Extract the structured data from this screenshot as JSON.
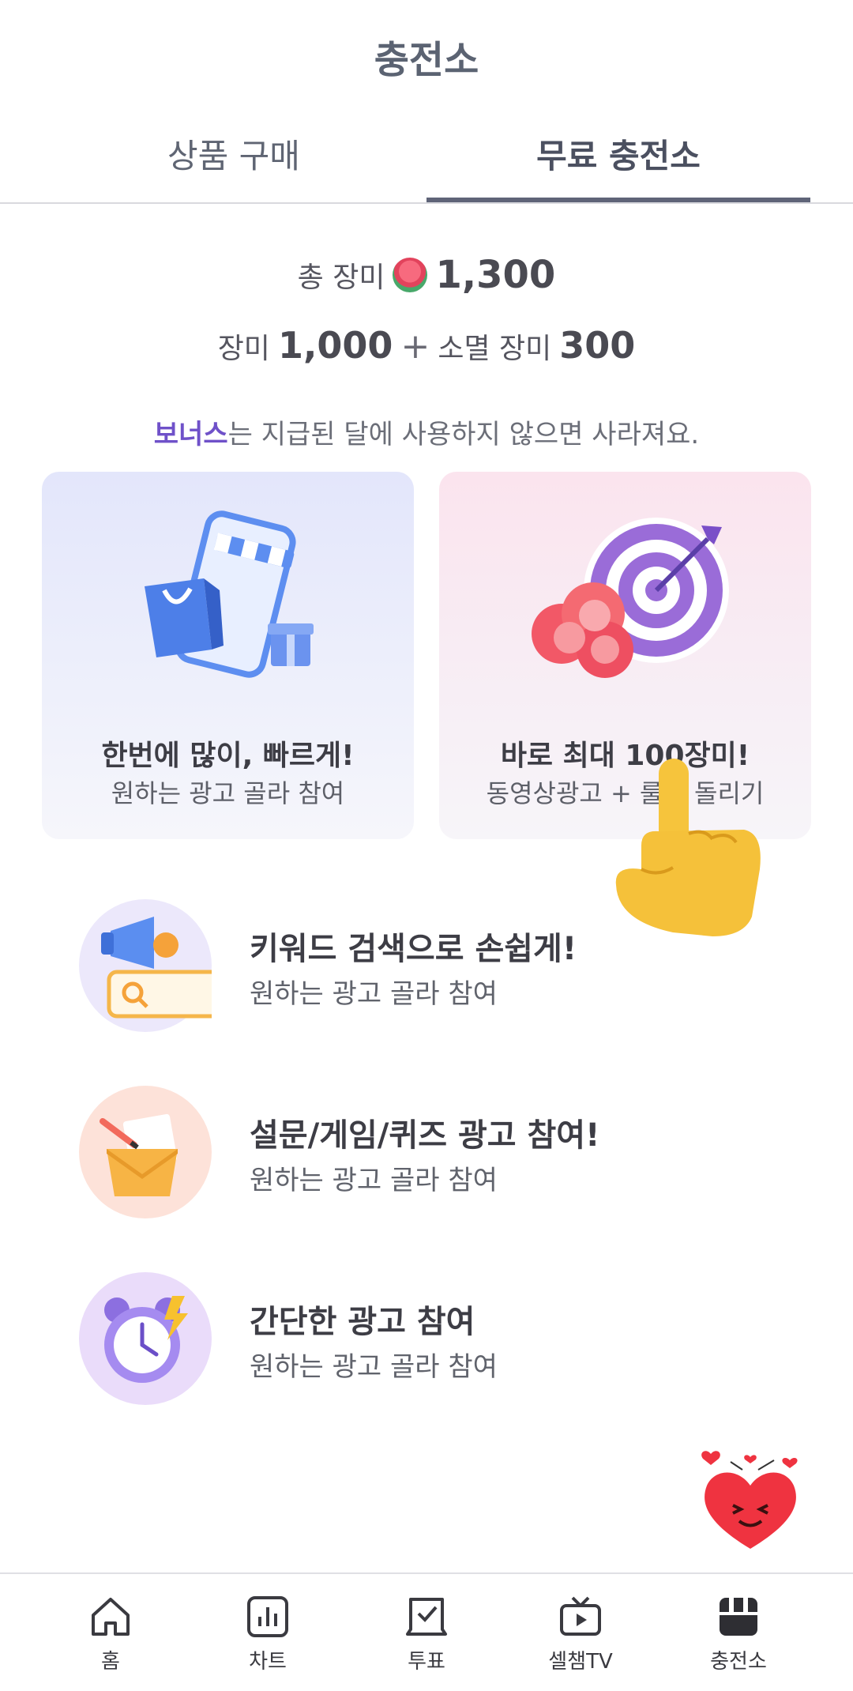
{
  "header": {
    "title": "충전소"
  },
  "tabs": [
    {
      "label": "상품 구매"
    },
    {
      "label": "무료 충전소",
      "active": true
    }
  ],
  "balance": {
    "total_label": "총 장미",
    "total_value": "1,300",
    "rose_label": "장미",
    "rose_value": "1,000",
    "plus": "+",
    "expiring_label": "소멸 장미",
    "expiring_value": "300"
  },
  "notice": {
    "bonus": "보너스",
    "text": "는 지급된 달에 사용하지 않으면 사라져요."
  },
  "cards": [
    {
      "title": "한번에 많이, 빠르게!",
      "subtitle": "원하는 광고 골라 참여",
      "icon": "shopping-phone-icon"
    },
    {
      "title": "바로 최대 100장미!",
      "subtitle": "동영상광고 + 룰렛 돌리기",
      "icon": "target-roses-icon"
    }
  ],
  "list": [
    {
      "title": "키워드 검색으로 손쉽게!",
      "subtitle": "원하는 광고 골라 참여",
      "icon": "megaphone-search-icon"
    },
    {
      "title": "설문/게임/퀴즈 광고 참여!",
      "subtitle": "원하는 광고 골라 참여",
      "icon": "envelope-pencil-icon"
    },
    {
      "title": "간단한 광고 참여",
      "subtitle": "원하는 광고 골라 참여",
      "icon": "alarm-clock-icon"
    }
  ],
  "bottom_nav": [
    {
      "label": "홈",
      "icon": "home-icon"
    },
    {
      "label": "차트",
      "icon": "chart-icon"
    },
    {
      "label": "투표",
      "icon": "vote-icon"
    },
    {
      "label": "셀챔TV",
      "icon": "tv-icon"
    },
    {
      "label": "충전소",
      "icon": "store-icon",
      "active": true
    }
  ],
  "colors": {
    "accent": "#6f51c9",
    "tab_underline": "#5f6478",
    "card_left_bg": "#e3e6fb",
    "card_right_bg": "#fbe4ee"
  }
}
